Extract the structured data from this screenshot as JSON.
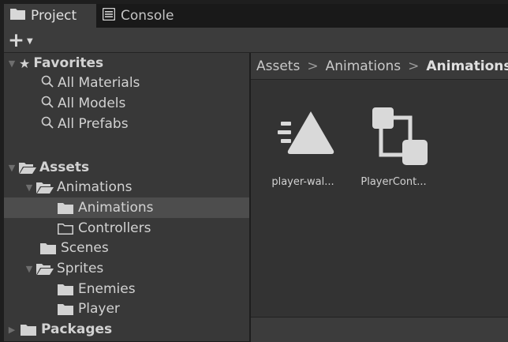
{
  "tabs": [
    {
      "label": "Project",
      "icon": "folder-icon",
      "active": true
    },
    {
      "label": "Console",
      "icon": "console-icon",
      "active": false
    }
  ],
  "toolbar": {
    "create_label": "+",
    "create_menu_icon": "caret-down-icon"
  },
  "tree": {
    "favorites": {
      "label": "Favorites",
      "items": [
        "All Materials",
        "All Models",
        "All Prefabs"
      ]
    },
    "assets": {
      "label": "Assets",
      "animations": "Animations",
      "animations_sub": "Animations",
      "controllers": "Controllers",
      "scenes": "Scenes",
      "sprites": "Sprites",
      "enemies": "Enemies",
      "player": "Player"
    },
    "packages": {
      "label": "Packages"
    },
    "selected": "Animations"
  },
  "breadcrumb": [
    "Assets",
    "Animations",
    "Animations"
  ],
  "assets_grid": [
    {
      "name": "player-wal...",
      "icon": "animation-clip-icon"
    },
    {
      "name": "PlayerCont...",
      "icon": "animator-controller-icon"
    }
  ],
  "colors": {
    "panel": "#383838",
    "selected_row": "#4d4d4d",
    "icon": "#d2d2d2",
    "text": "#d2d2d2"
  }
}
